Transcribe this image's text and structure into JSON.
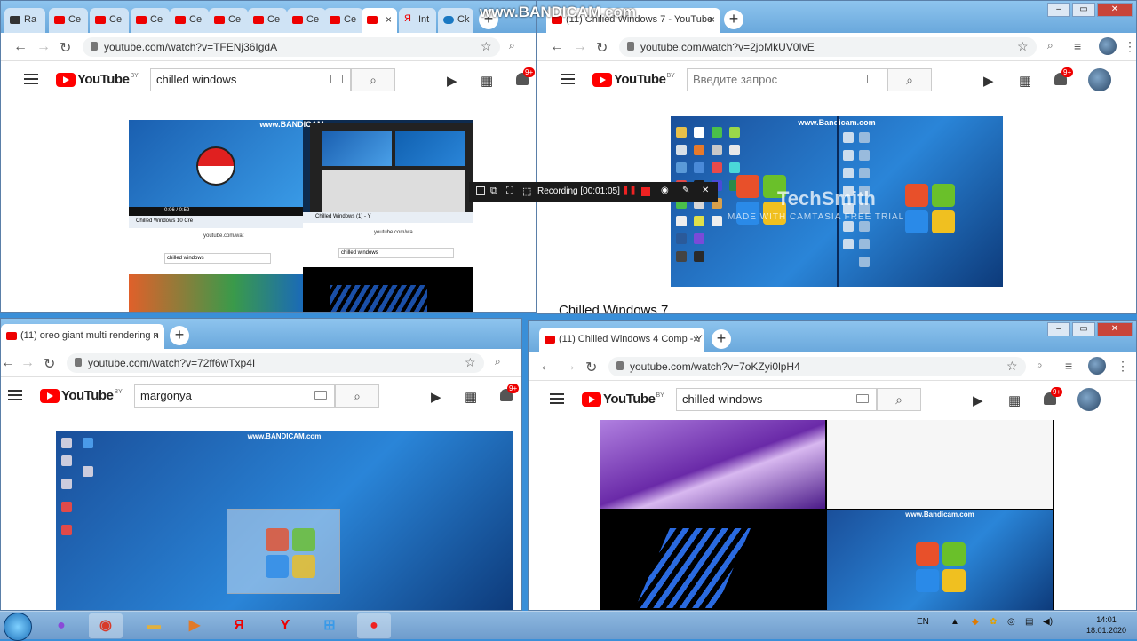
{
  "watermark": "www.BANDICAM.com",
  "win_tl": {
    "tabs": [
      "Ra",
      "Ce",
      "Ce",
      "Ce",
      "Ce",
      "Ce",
      "Ce",
      "Ce",
      "Ce",
      "",
      "Int",
      "Ck"
    ],
    "url": "youtube.com/watch?v=TFENj36IgdA",
    "search_value": "chilled windows",
    "badge": "9+",
    "by": "BY"
  },
  "win_tr": {
    "tab_title": "(11) Chilled Windows 7 - YouTube",
    "url": "youtube.com/watch?v=2joMkUV0IvE",
    "search_placeholder": "Введите запрос",
    "badge": "9+",
    "by": "BY",
    "video_title": "Chilled Windows 7",
    "overlay_brand": "TechSmith",
    "overlay_sub": "MADE WITH CAMTASIA FREE TRIAL",
    "inner_wm": "www.Bandicam.com"
  },
  "win_bl": {
    "tab_title": "(11) oreo giant multi rendering n",
    "url": "youtube.com/watch?v=72ff6wTxp4I",
    "search_value": "margonya",
    "badge": "9+",
    "by": "BY",
    "inner_wm": "www.BANDICAM.com"
  },
  "win_br": {
    "tab_title": "(11) Chilled Windows 4 Comp - Y",
    "url": "youtube.com/watch?v=7oKZyi0lpH4",
    "search_value": "chilled windows",
    "badge": "9+",
    "by": "BY",
    "inner_wm": "www.Bandicam.com"
  },
  "inner_tl": {
    "wm": "www.BANDICAM.com",
    "sub_tab1": "Chilled Windows 10 Cre",
    "sub_tab2": "Chilled Windows (1) - Y",
    "sub_url1": "youtube.com/wat",
    "sub_url2": "youtube.com/wa",
    "sub_search1": "chilled windows",
    "sub_search2": "chilled windows",
    "time": "0:06 / 0:52"
  },
  "recorder": {
    "label": "Recording [00:01:05]"
  },
  "taskbar": {
    "lang": "EN",
    "time": "14:01",
    "date": "18.01.2020"
  }
}
